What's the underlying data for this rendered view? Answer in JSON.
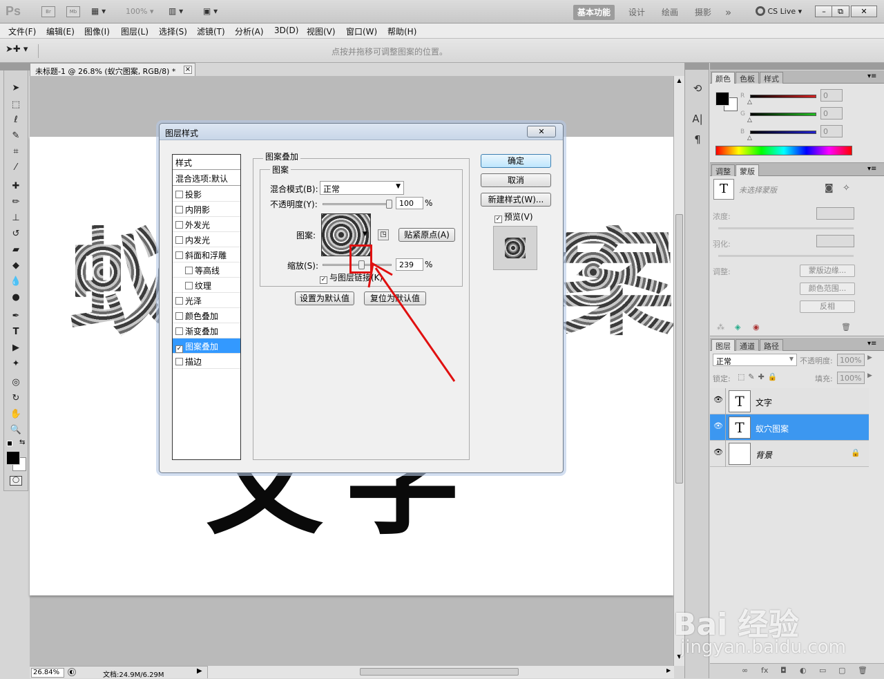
{
  "app": {
    "logo": "Ps",
    "mini_buttons": [
      "Br",
      "Mb"
    ],
    "zoom_select": "100%",
    "workspaces": [
      "基本功能",
      "设计",
      "绘画",
      "摄影"
    ],
    "more": "»",
    "cs_live": "CS Live",
    "window_buttons": [
      "–",
      "⧉",
      "✕"
    ]
  },
  "menu": [
    "文件(F)",
    "编辑(E)",
    "图像(I)",
    "图层(L)",
    "选择(S)",
    "滤镜(T)",
    "分析(A)",
    "3D(D)",
    "视图(V)",
    "窗口(W)",
    "帮助(H)"
  ],
  "options_bar": {
    "hint": "点按并拖移可调整图案的位置。"
  },
  "document": {
    "tab_title": "未标题-1 @ 26.8% (蚁穴图案, RGB/8) *",
    "close": "×",
    "text_top": [
      "蚁",
      "案"
    ],
    "text_bottom": [
      "文",
      "字"
    ]
  },
  "status": {
    "zoom": "26.84%",
    "doc_size": "文档:24.9M/6.29M"
  },
  "dialog": {
    "title": "图层样式",
    "close": "✕",
    "styles_header": "样式",
    "blend_default": "混合选项:默认",
    "styles": [
      {
        "label": "投影",
        "checked": false,
        "indent": false
      },
      {
        "label": "内阴影",
        "checked": false,
        "indent": false
      },
      {
        "label": "外发光",
        "checked": false,
        "indent": false
      },
      {
        "label": "内发光",
        "checked": false,
        "indent": false
      },
      {
        "label": "斜面和浮雕",
        "checked": false,
        "indent": false
      },
      {
        "label": "等高线",
        "checked": false,
        "indent": true
      },
      {
        "label": "纹理",
        "checked": false,
        "indent": true
      },
      {
        "label": "光泽",
        "checked": false,
        "indent": false
      },
      {
        "label": "颜色叠加",
        "checked": false,
        "indent": false
      },
      {
        "label": "渐变叠加",
        "checked": false,
        "indent": false
      },
      {
        "label": "图案叠加",
        "checked": true,
        "indent": false
      },
      {
        "label": "描边",
        "checked": false,
        "indent": false
      }
    ],
    "section_title": "图案叠加",
    "group_title": "图案",
    "blend_mode_label": "混合模式(B):",
    "blend_mode_value": "正常",
    "opacity_label": "不透明度(Y):",
    "opacity_value": "100",
    "opacity_level": 1.0,
    "percent": "%",
    "pattern_label": "图案:",
    "snap_origin": "贴紧原点(A)",
    "scale_label": "缩放(S):",
    "scale_value": "239",
    "scale_level": 0.56,
    "link_label": "与图层链接(K)",
    "link_checked": true,
    "set_default": "设置为默认值",
    "reset_default": "复位为默认值",
    "ok": "确定",
    "cancel": "取消",
    "new_style": "新建样式(W)...",
    "preview_label": "预览(V)",
    "preview_checked": true
  },
  "color_panel": {
    "tabs": [
      "颜色",
      "色板",
      "样式"
    ],
    "channels": [
      {
        "name": "R",
        "value": "0",
        "color": "#d42020"
      },
      {
        "name": "G",
        "value": "0",
        "color": "#20c020"
      },
      {
        "name": "B",
        "value": "0",
        "color": "#2020d0"
      }
    ]
  },
  "mask_panel": {
    "tabs": [
      "调整",
      "蒙版"
    ],
    "no_mask": "未选择蒙版",
    "density": "浓度:",
    "feather": "羽化:",
    "refine": "调整:",
    "mask_edge": "蒙版边缘...",
    "color_range": "颜色范围...",
    "invert": "反相"
  },
  "layers_panel": {
    "tabs": [
      "图层",
      "通道",
      "路径"
    ],
    "blend": "正常",
    "opacity_label": "不透明度:",
    "opacity_value": "100%",
    "lock_label": "锁定:",
    "fill_label": "填充:",
    "fill_value": "100%",
    "layers": [
      {
        "name": "文字",
        "thumb": "T",
        "selected": false,
        "italic": false
      },
      {
        "name": "蚁穴图案",
        "thumb": "T",
        "selected": true,
        "italic": false
      },
      {
        "name": "背景",
        "thumb": "",
        "selected": false,
        "italic": true
      }
    ],
    "footer_icons": [
      "∞",
      "fx",
      "◘",
      "◐",
      "▭",
      "▢",
      "🗑"
    ]
  },
  "watermark": {
    "brand": "Bai 经验",
    "url": "jingyan.baidu.com"
  },
  "colors": {
    "selection": "#3c97f0",
    "annotation": "#e01010",
    "workspace_active": "#9c9c9c"
  }
}
